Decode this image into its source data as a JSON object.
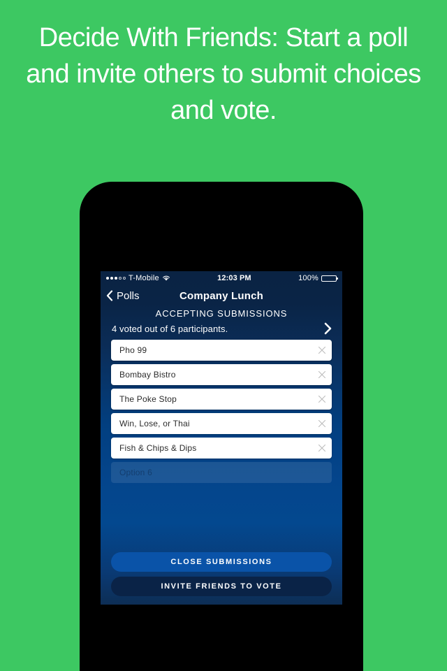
{
  "promo": {
    "headline": "Decide With Friends: Start a poll and invite others to submit choices and vote.",
    "background_color": "#3dc862",
    "text_color": "#ffffff"
  },
  "device": {
    "frame_color": "#000000",
    "screen_gradient_top": "#0a2343",
    "screen_gradient_mid": "#04458c",
    "screen_gradient_bottom": "#0d2e55"
  },
  "status_bar": {
    "signal_dots_filled": 3,
    "signal_dots_hollow": 2,
    "carrier": "T-Mobile",
    "wifi_icon": "wifi-icon",
    "time": "12:03 PM",
    "battery_percent": "100%",
    "battery_level": 100
  },
  "nav_bar": {
    "back_icon": "chevron-left-icon",
    "back_label": "Polls",
    "title": "Company Lunch"
  },
  "poll": {
    "status_label": "ACCEPTING SUBMISSIONS",
    "participants_text": "4 voted out of 6 participants.",
    "participants_chevron": "chevron-right-icon",
    "voted_count": 4,
    "participant_count": 6,
    "options": [
      {
        "text": "Pho 99",
        "empty": false,
        "clear_icon": "close-icon"
      },
      {
        "text": "Bombay Bistro",
        "empty": false,
        "clear_icon": "close-icon"
      },
      {
        "text": "The Poke Stop",
        "empty": false,
        "clear_icon": "close-icon"
      },
      {
        "text": "Win, Lose, or Thai",
        "empty": false,
        "clear_icon": "close-icon"
      },
      {
        "text": "Fish & Chips & Dips",
        "empty": false,
        "clear_icon": "close-icon"
      },
      {
        "text": "",
        "placeholder": "Option 6",
        "empty": true
      }
    ]
  },
  "actions": {
    "close_submissions_label": "CLOSE SUBMISSIONS",
    "close_submissions_color": "#0a53a8",
    "invite_friends_label": "INVITE FRIENDS TO VOTE",
    "invite_friends_color": "#0a2347"
  }
}
